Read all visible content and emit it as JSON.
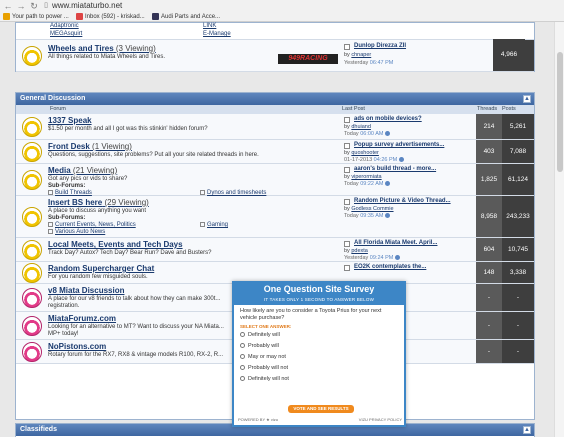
{
  "browser": {
    "url": "www.miataturbo.net",
    "bookmarks": [
      {
        "label": "Your path to power ...",
        "color": "#e8a000"
      },
      {
        "label": "Inbox (592) - kriskad...",
        "color": "#d44"
      },
      {
        "label": "Audi Parts and Acce...",
        "color": "#335"
      }
    ]
  },
  "top_section": {
    "subforums_left": [
      "Adaptronic",
      "MEGAsquirt"
    ],
    "subforums_right": [
      "LINK",
      "E-Manage"
    ],
    "wheels_row": {
      "title": "Wheels and Tires",
      "viewing": "(3 Viewing)",
      "desc": "All things related to Miata Wheels and Tires.",
      "sponsor": "949RACING",
      "last_post_title": "Dunlop Direzza ZII",
      "last_post_by": "by",
      "last_post_user": "chnaper",
      "last_post_date": "Yesterday",
      "last_post_time": "06:47 PM",
      "threads": "204",
      "posts": "4,966"
    }
  },
  "general": {
    "title": "General Discussion",
    "col_forum": "Forum",
    "col_last_post": "Last Post",
    "col_threads": "Threads",
    "col_posts": "Posts",
    "collapse_symbol": "▲",
    "forums": [
      {
        "title": "1337 Speak",
        "viewing": "",
        "desc": "$1.50 per month and all I got was this stinkin' hidden forum?",
        "sub_label": "",
        "subs": [],
        "last_title": "ads on mobile devices?",
        "last_user": "dhuiand",
        "last_date": "Today",
        "last_time": "06:00 AM",
        "threads": "214",
        "posts": "5,261",
        "color": "yellow"
      },
      {
        "title": "Front Desk",
        "viewing": "(1 Viewing)",
        "desc": "Questions, suggestions, site problems? Put all your site related threads in here.",
        "sub_label": "",
        "subs": [],
        "last_title": "Popup survey advertisements...",
        "last_user": "quoshooter",
        "last_date": "01-17-2013",
        "last_time": "04:26 PM",
        "threads": "403",
        "posts": "7,088",
        "color": "yellow"
      },
      {
        "title": "Media",
        "viewing": "(21 Viewing)",
        "desc": "Got any pics or vids to share?",
        "sub_label": "Sub-Forums:",
        "subs": [
          "Build Threads",
          "Dynos and timesheets"
        ],
        "last_title": "aaron's build thread - more...",
        "last_user": "viperormiata",
        "last_date": "Today",
        "last_time": "09:22 AM",
        "threads": "1,825",
        "posts": "61,124",
        "color": "yellow"
      },
      {
        "title": "Insert BS here",
        "viewing": "(29 Viewing)",
        "desc": "A place to discuss anything you want",
        "sub_label": "Sub-Forums:",
        "subs": [
          "Current Events, News, Politics",
          "Gaming",
          "Various Auto News"
        ],
        "last_title": "Random Picture & Video Thread...",
        "last_user": "Godless Commie",
        "last_date": "Today",
        "last_time": "09:35 AM",
        "threads": "8,958",
        "posts": "243,233",
        "color": "yellow"
      },
      {
        "title": "Local Meets, Events and Tech Days",
        "viewing": "",
        "desc": "Track Day? Autox? Tech Day? Bear Run? Dave and Busters?",
        "sub_label": "",
        "subs": [],
        "last_title": "All Florida Miata Meet. April...",
        "last_user": "pdexta",
        "last_date": "Yesterday",
        "last_time": "09:24 PM",
        "threads": "604",
        "posts": "10,745",
        "color": "yellow"
      },
      {
        "title": "Random Supercharger Chat",
        "viewing": "",
        "desc": "For you random few misguided souls.",
        "sub_label": "",
        "subs": [],
        "last_title": "EO2K contemplates the...",
        "last_user": "",
        "last_date": "",
        "last_time": "",
        "threads": "148",
        "posts": "3,338",
        "color": "yellow"
      },
      {
        "title": "v8 Miata Discussion",
        "viewing": "",
        "desc": "A place for our v8 friends to talk about how they can make 300t...",
        "desc2": "registration.",
        "sub_label": "",
        "subs": [],
        "last_title": "",
        "last_user": "",
        "last_date": "",
        "last_time": "",
        "threads": "-",
        "posts": "-",
        "color": "pink"
      },
      {
        "title": "MiataForumz.com",
        "viewing": "",
        "desc": "Looking for an alternative to MT? Want to discuss your NA Miata...",
        "desc2": "MP+ today!",
        "sub_label": "",
        "subs": [],
        "last_title": "",
        "last_user": "",
        "last_date": "",
        "last_time": "",
        "threads": "-",
        "posts": "-",
        "color": "pink"
      },
      {
        "title": "NoPistons.com",
        "viewing": "",
        "desc": "Rotary forum for the RX7, RX8 & vintage models R100, RX-2, R...",
        "sub_label": "",
        "subs": [],
        "last_title": "",
        "last_user": "",
        "last_date": "",
        "last_time": "",
        "threads": "-",
        "posts": "-",
        "color": "pink"
      }
    ]
  },
  "classifieds": {
    "title": "Classifieds",
    "collapse_symbol": "▲"
  },
  "survey": {
    "title": "One Question Site Survey",
    "subtitle": "IT TAKES ONLY 1 SECOND TO ANSWER BELOW",
    "question": "How likely are you to consider a Toyota Prius for your next vehicle purchase?",
    "select_label": "SELECT ONE ANSWER:",
    "options": [
      "Definitely will",
      "Probably will",
      "May or may not",
      "Probably will not",
      "Definitely will not"
    ],
    "vote_label": "VOTE AND SEE RESULTS",
    "powered_by": "POWERED BY ★ vizu",
    "privacy": "VIZU PRIVACY POLICY"
  }
}
